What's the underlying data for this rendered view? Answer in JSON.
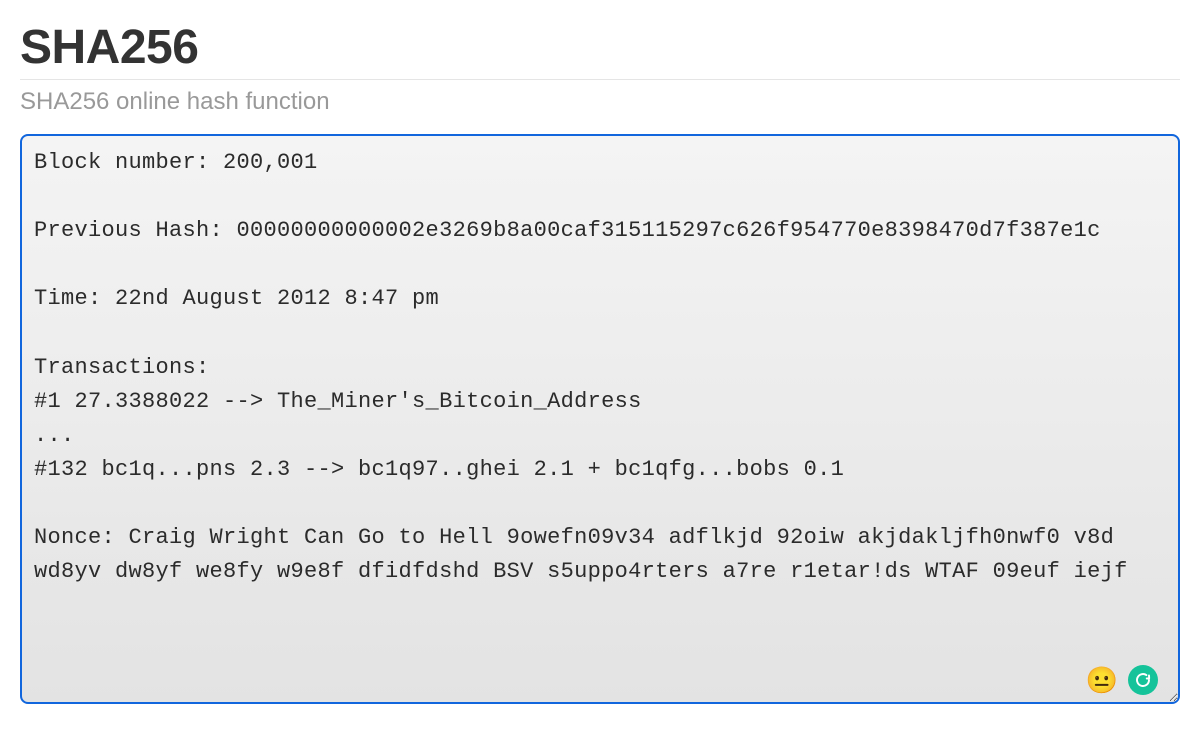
{
  "page": {
    "title": "SHA256",
    "subtitle": "SHA256 online hash function"
  },
  "input": {
    "value": "Block number: 200,001\n\nPrevious Hash: 00000000000002e3269b8a00caf315115297c626f954770e8398470d7f387e1c\n\nTime: 22nd August 2012 8:47 pm\n\nTransactions:\n#1 27.3388022 --> The_Miner's_Bitcoin_Address\n...\n#132 bc1q...pns 2.3 --> bc1q97..ghei 2.1 + bc1qfg...bobs 0.1\n\nNonce: Craig Wright Can Go to Hell 9owefn09v34 adflkjd 92oiw akjdakljfh0nwf0 v8d wd8yv dw8yf we8fy w9e8f dfidfdshd BSV s5uppo4rters a7re r1etar!ds WTAF 09euf iejf"
  },
  "icons": {
    "emoji": "😐"
  }
}
